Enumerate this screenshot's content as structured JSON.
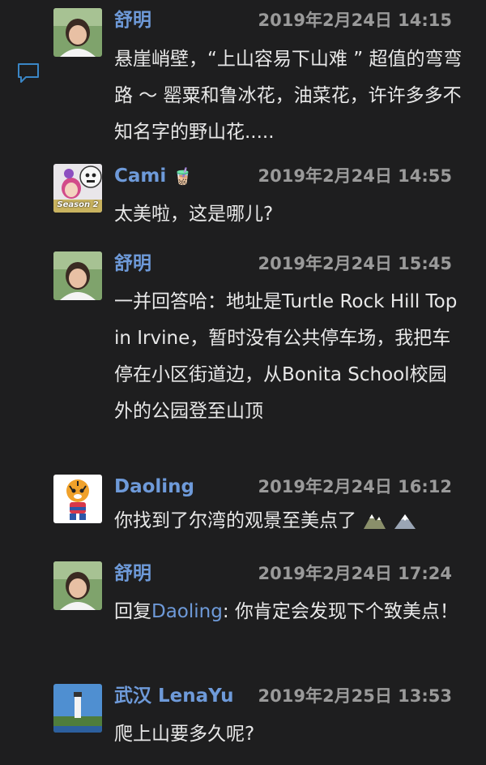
{
  "comments": [
    {
      "author": "舒明",
      "time": "2019年2月24日 14:15",
      "text": "悬崖峭壁，“上山容易下山难 ” 超值的弯弯路 ～ 罂粟和鲁冰花，油菜花，许许多多不知名字的野山花....."
    },
    {
      "author": "Cami",
      "author_emoji": "🧋",
      "time": "2019年2月24日 14:55",
      "text": "太美啦，这是哪儿?",
      "avatar_text": "Season 2"
    },
    {
      "author": "舒明",
      "time": "2019年2月24日 15:45",
      "text": "一并回答哈：地址是Turtle Rock Hill Top in Irvine，暂时没有公共停车场，我把车停在小区街道边，从Bonita School校园外的公园登至山顶"
    },
    {
      "author": "Daoling",
      "time": "2019年2月24日 16:12",
      "text": "你找到了尔湾的观景至美点了"
    },
    {
      "author": "舒明",
      "time": "2019年2月24日 17:24",
      "reply_prefix": "回复",
      "reply_to": "Daoling",
      "text": ": 你肯定会发现下个致美点！"
    },
    {
      "author": "武汉 LenaYu",
      "time": "2019年2月25日 13:53",
      "text": "爬上山要多久呢?"
    }
  ],
  "colors": {
    "background": "#1e1e1f",
    "author": "#6e9ad9",
    "time": "#9a9a9a",
    "text": "#e8e8e8"
  }
}
